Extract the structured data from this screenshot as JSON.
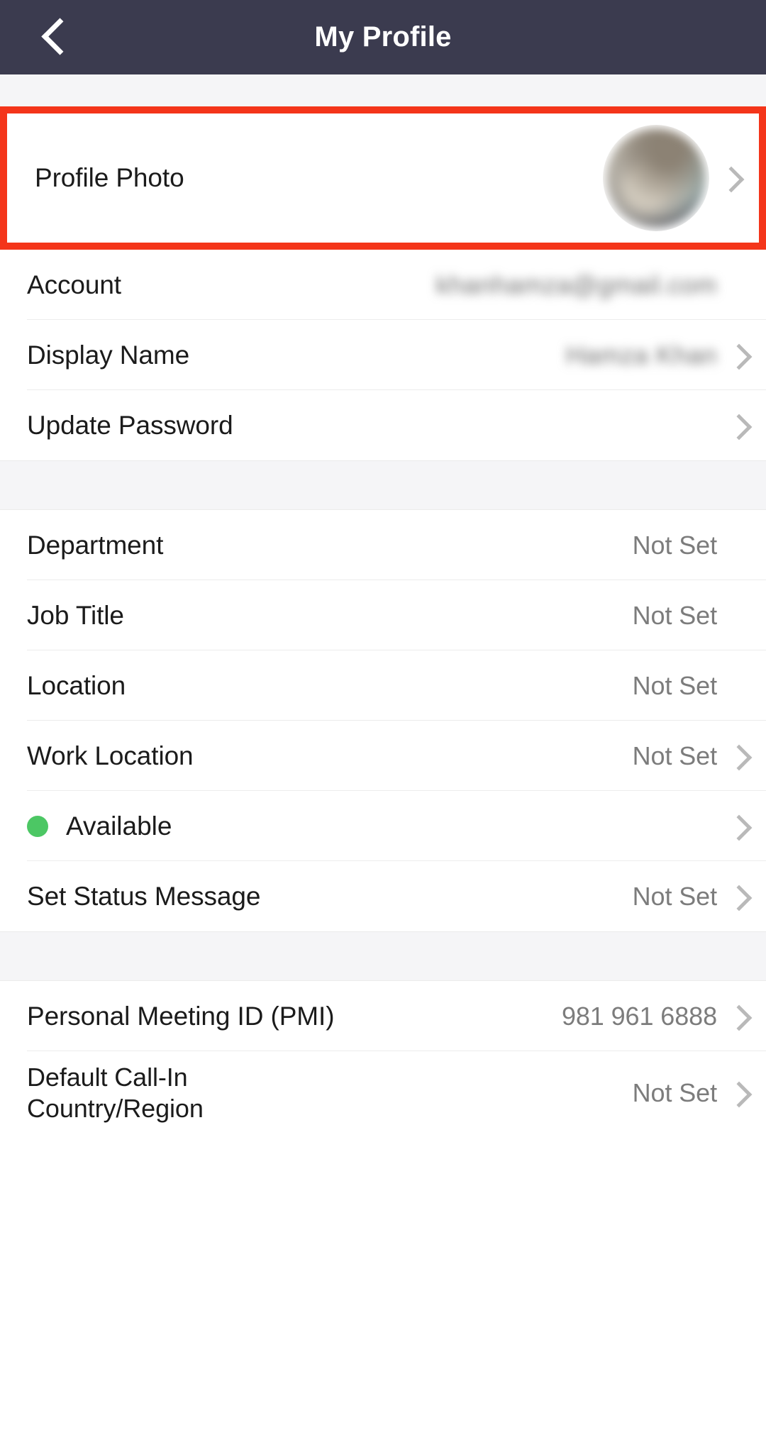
{
  "header": {
    "title": "My Profile",
    "back_icon": "chevron-left-icon",
    "background_color": "#3B3B4F"
  },
  "colors": {
    "highlight": "#F4351A",
    "status_available": "#4CC764",
    "section_gap": "#F5F5F7",
    "value_text": "#8A8A8A",
    "label_text": "#1B1B1B"
  },
  "sections": [
    {
      "id": "profile-photo-section",
      "highlighted": true,
      "rows": [
        {
          "id": "profile-photo",
          "label": "Profile Photo",
          "value": "",
          "redacted_value": false,
          "avatar": true,
          "chevron": true
        }
      ]
    },
    {
      "id": "account-section",
      "highlighted": false,
      "rows": [
        {
          "id": "account",
          "label": "Account",
          "value": "khanhamza@gmail.com",
          "redacted_value": true,
          "chevron": false
        },
        {
          "id": "display-name",
          "label": "Display Name",
          "value": "Hamza Khan",
          "redacted_value": true,
          "chevron": true
        },
        {
          "id": "update-password",
          "label": "Update Password",
          "value": "",
          "redacted_value": false,
          "chevron": true
        }
      ]
    },
    {
      "id": "work-info-section",
      "highlighted": false,
      "rows": [
        {
          "id": "department",
          "label": "Department",
          "value": "Not Set",
          "redacted_value": false,
          "chevron": false
        },
        {
          "id": "job-title",
          "label": "Job Title",
          "value": "Not Set",
          "redacted_value": false,
          "chevron": false
        },
        {
          "id": "location",
          "label": "Location",
          "value": "Not Set",
          "redacted_value": false,
          "chevron": false
        },
        {
          "id": "work-location",
          "label": "Work Location",
          "value": "Not Set",
          "redacted_value": false,
          "chevron": true
        },
        {
          "id": "availability-status",
          "label": "Available",
          "value": "",
          "status_dot": true,
          "redacted_value": false,
          "chevron": true
        },
        {
          "id": "set-status-message",
          "label": "Set Status Message",
          "value": "Not Set",
          "redacted_value": false,
          "chevron": true
        }
      ]
    },
    {
      "id": "meeting-section",
      "highlighted": false,
      "rows": [
        {
          "id": "personal-meeting-id",
          "label": "Personal Meeting ID (PMI)",
          "value": "981 961 6888",
          "redacted_value": false,
          "chevron": true
        },
        {
          "id": "default-call-in-country",
          "label_line1": "Default Call-In",
          "label_line2": "Country/Region",
          "label": "Default Call-In Country/Region",
          "value": "Not Set",
          "redacted_value": false,
          "chevron": true
        }
      ]
    }
  ]
}
